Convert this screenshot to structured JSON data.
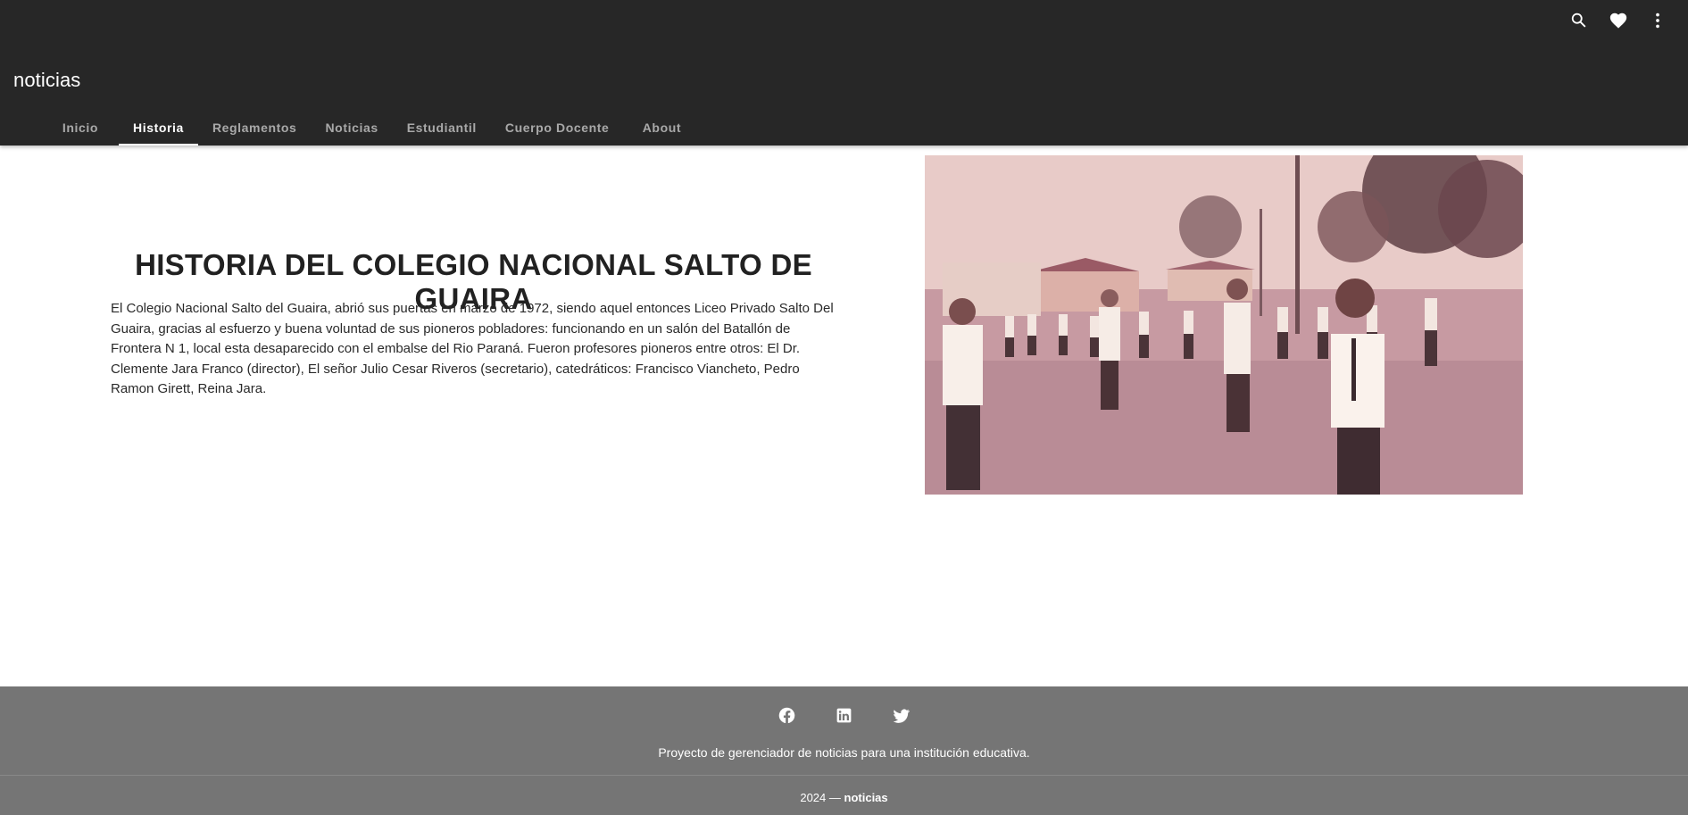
{
  "app": {
    "title": "noticias"
  },
  "toolbar": {
    "icons": [
      "search-icon",
      "heart-icon",
      "dots-vertical-icon"
    ]
  },
  "tabs": [
    {
      "label": "Inicio",
      "active": false
    },
    {
      "label": "Historia",
      "active": true
    },
    {
      "label": "Reglamentos",
      "active": false
    },
    {
      "label": "Noticias",
      "active": false
    },
    {
      "label": "Estudiantil",
      "active": false
    },
    {
      "label": "Cuerpo Docente",
      "active": false
    },
    {
      "label": "About",
      "active": false
    }
  ],
  "main": {
    "title": "HISTORIA DEL COLEGIO NACIONAL SALTO DE GUAIRA",
    "body": "El Colegio Nacional Salto del Guaira, abrió sus puertas en marzo de 1972, siendo aquel entonces Liceo Privado Salto Del Guaira, gracias al esfuerzo y buena voluntad de sus pioneros pobladores: funcionando en un salón del Batallón de Frontera N 1, local esta desaparecido con el embalse del Rio Paraná. Fueron profesores pioneros entre otros: El Dr. Clemente Jara Franco (director), El señor Julio Cesar Riveros (secretario), catedráticos: Francisco Viancheto, Pedro Ramon Girett, Reina Jara."
  },
  "footer": {
    "social": [
      "facebook-icon",
      "linkedin-icon",
      "twitter-icon"
    ],
    "description": "Proyecto de gerenciador de noticias para una institución educativa.",
    "year_prefix": "2024 —",
    "brand": "noticias"
  },
  "colors": {
    "appbar": "#272727",
    "footer": "#757575",
    "text": "#212121",
    "tab_inactive": "rgba(255,255,255,0.6)"
  }
}
